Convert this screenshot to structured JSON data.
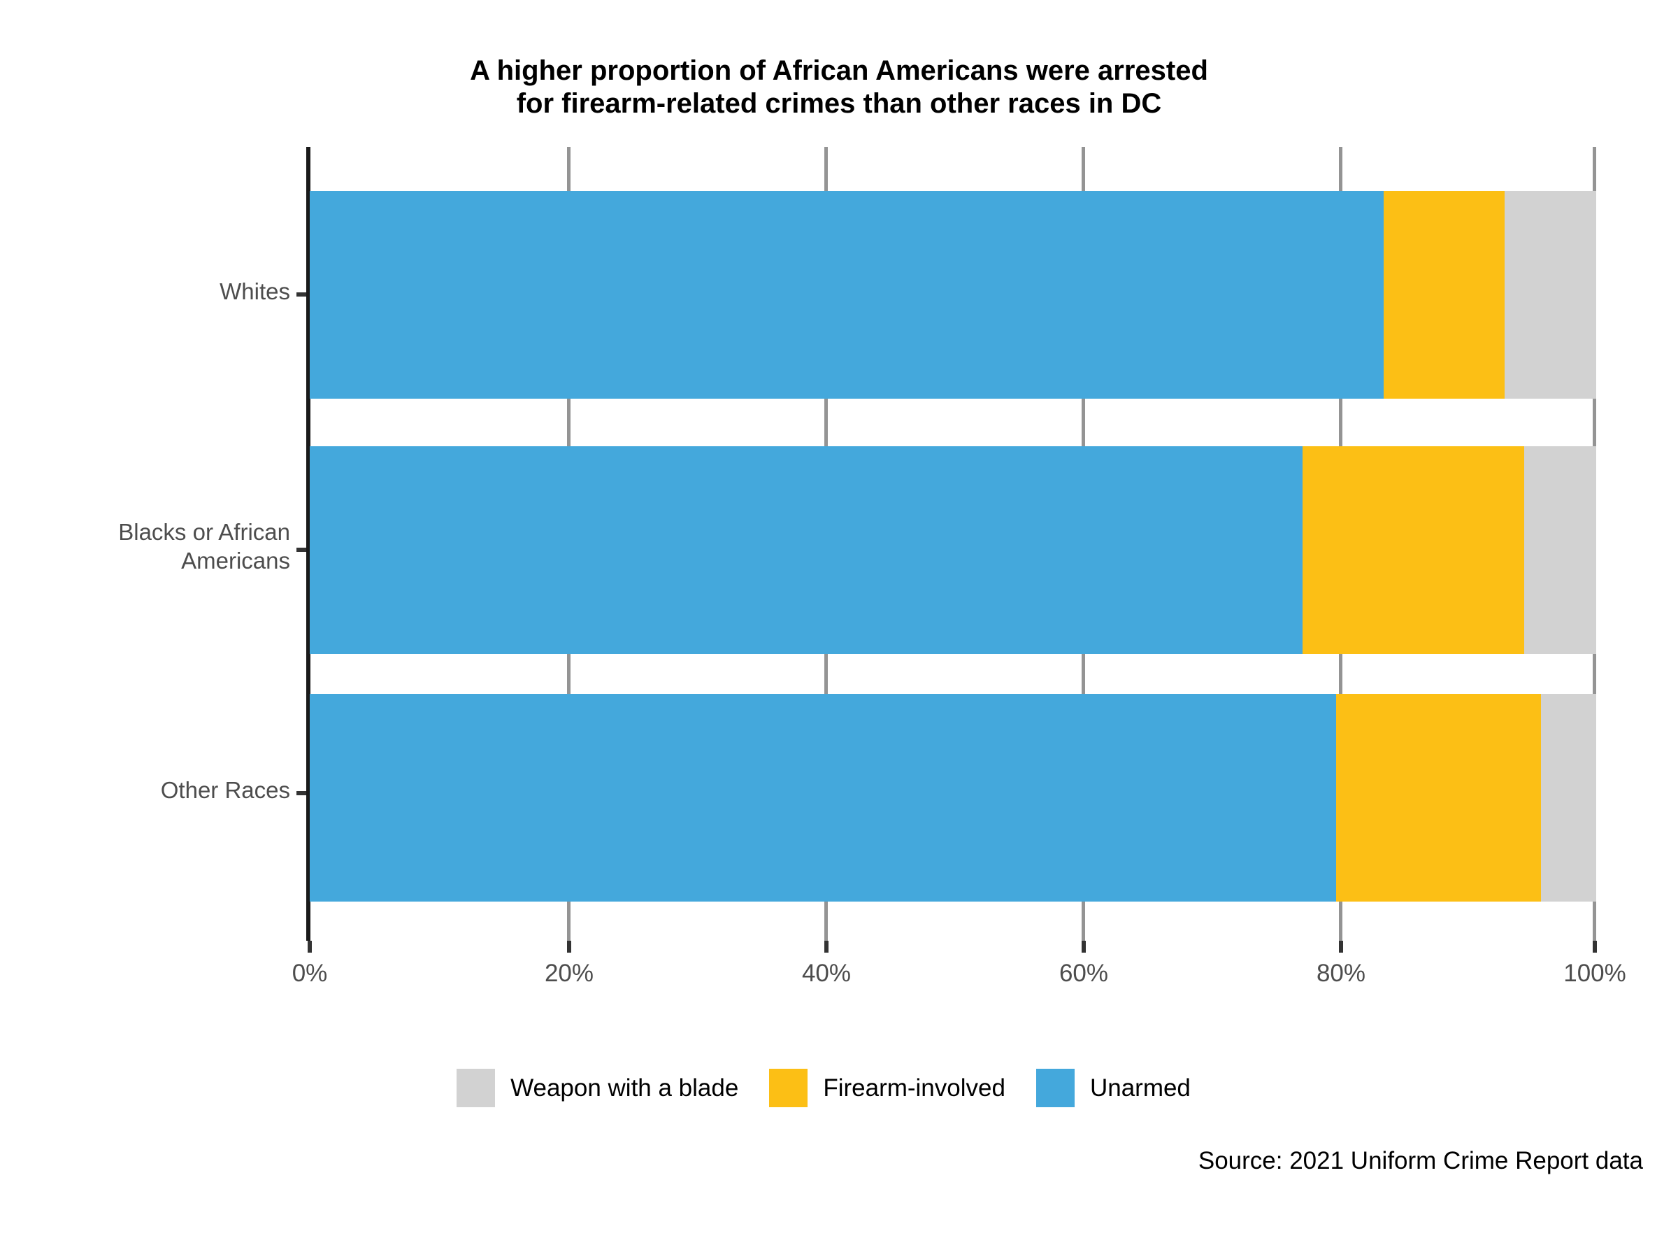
{
  "chart_data": {
    "type": "bar",
    "title": "A higher proportion of African Americans were arrested\nfor firearm-related crimes than other races in DC",
    "orientation": "horizontal",
    "stacked": true,
    "stacked_mode": "percent",
    "xlabel": "",
    "ylabel": "",
    "xlim": [
      0,
      100
    ],
    "xticks": [
      0,
      20,
      40,
      60,
      80,
      100
    ],
    "xticklabels": [
      "0%",
      "20%",
      "40%",
      "60%",
      "80%",
      "100%"
    ],
    "grid": true,
    "grid_axis": "x",
    "legend_position": "bottom",
    "categories": [
      "Whites",
      "Blacks or African Americans",
      "Other Races"
    ],
    "series": [
      {
        "name": "Unarmed",
        "color": "#44a8dc",
        "values": [
          83.5,
          77.2,
          79.8
        ]
      },
      {
        "name": "Firearm-involved",
        "color": "#fcbf15",
        "values": [
          9.4,
          17.2,
          15.9
        ]
      },
      {
        "name": "Weapon with a blade",
        "color": "#d2d2d2",
        "values": [
          7.1,
          5.6,
          4.3
        ]
      }
    ],
    "legend_order": [
      "Weapon with a blade",
      "Firearm-involved",
      "Unarmed"
    ],
    "source": "Source: 2021 Uniform Crime Report data"
  },
  "chart": {
    "title": "A higher proportion of African Americans were arrested\nfor firearm-related crimes than other races in DC",
    "source": "Source: 2021 Uniform Crime Report data",
    "y_categories": [
      {
        "label": "Whites"
      },
      {
        "label": "Blacks or African\nAmericans"
      },
      {
        "label": "Other Races"
      }
    ],
    "x_ticks": [
      {
        "label": "0%"
      },
      {
        "label": "20%"
      },
      {
        "label": "40%"
      },
      {
        "label": "60%"
      },
      {
        "label": "80%"
      },
      {
        "label": "100%"
      }
    ],
    "legend": [
      {
        "label": "Weapon with a blade",
        "color": "#d2d2d2"
      },
      {
        "label": "Firearm-involved",
        "color": "#fcbf15"
      },
      {
        "label": "Unarmed",
        "color": "#44a8dc"
      }
    ]
  },
  "colors": {
    "unarmed": "#44a8dc",
    "firearm": "#fcbf15",
    "blade": "#d2d2d2",
    "axis": "#1a1a1a",
    "gridline": "#949494",
    "tick_text": "#4d4d4d",
    "title_text": "#000000"
  }
}
